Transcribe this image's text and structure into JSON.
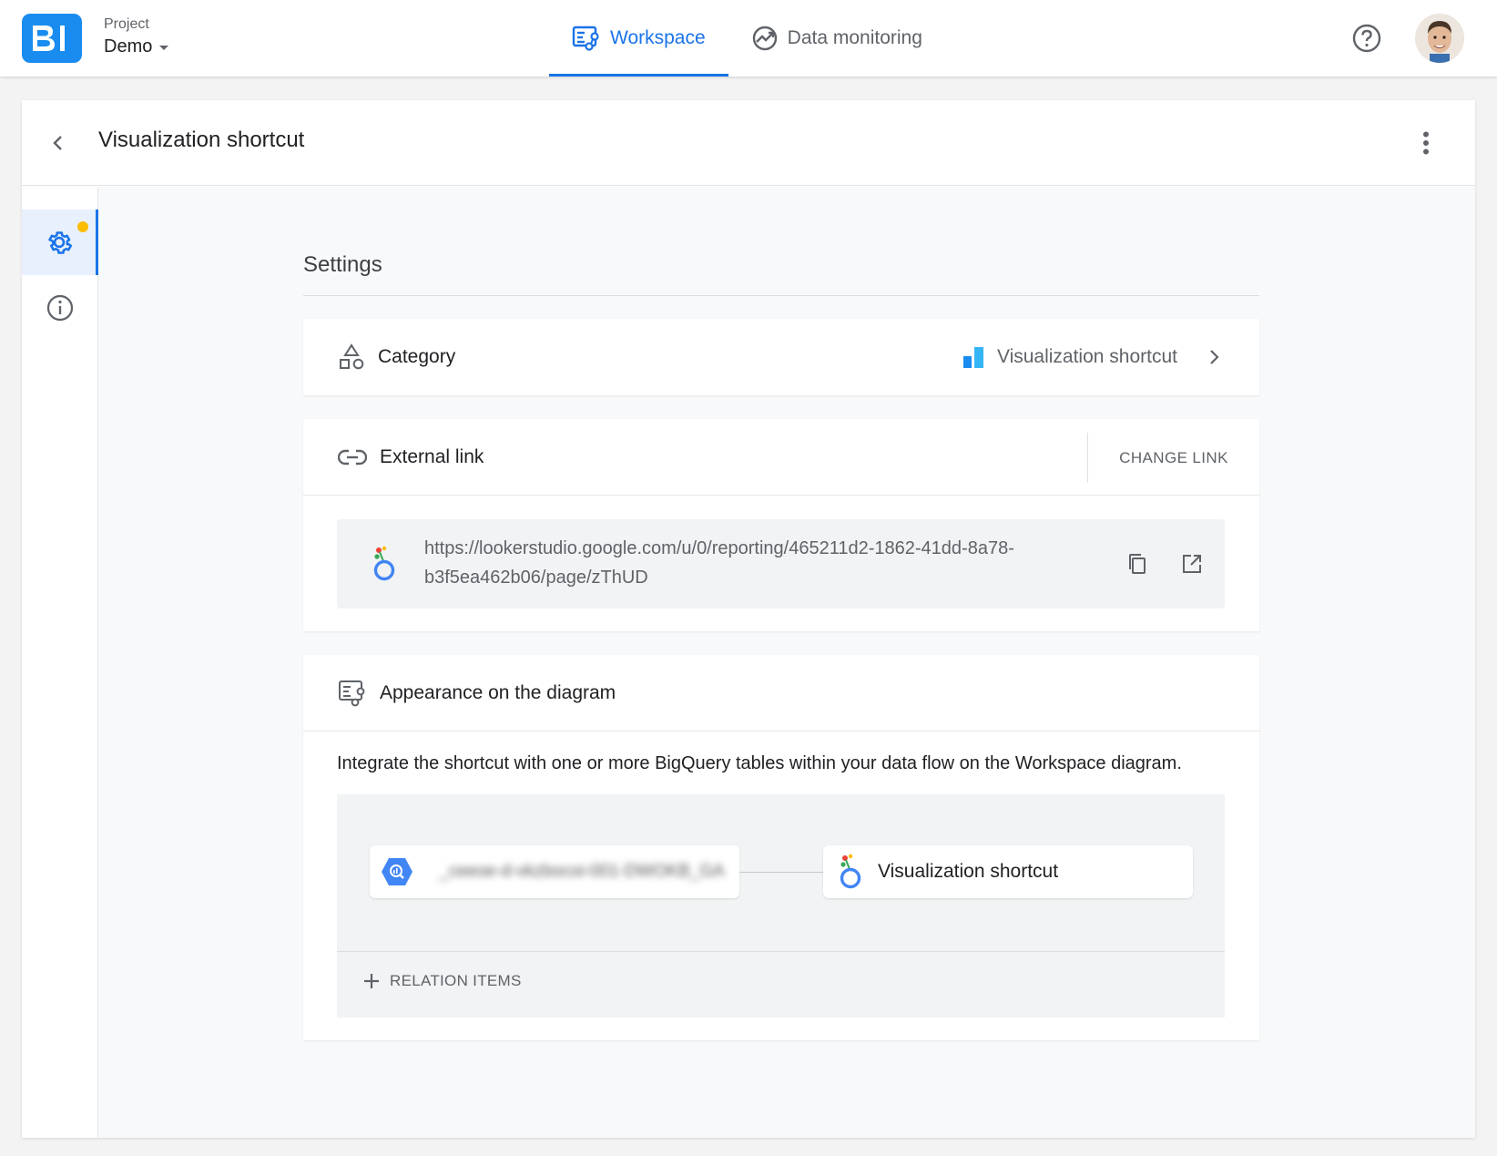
{
  "topbar": {
    "logo_text": "BI",
    "project_label": "Project",
    "project_name": "Demo",
    "tabs": [
      {
        "label": "Workspace",
        "active": true,
        "icon": "workspace-diagram-icon"
      },
      {
        "label": "Data monitoring",
        "active": false,
        "icon": "monitoring-icon"
      }
    ],
    "help_icon": "help-circle-icon",
    "accent_color": "#1a73e8",
    "logo_color": "#1a8cf0"
  },
  "page": {
    "title": "Visualization shortcut",
    "back_icon": "chevron-left-icon",
    "menu_icon": "more-vert-icon"
  },
  "side_rail": {
    "items": [
      {
        "name": "settings",
        "icon": "gear-icon",
        "active": true,
        "has_notification": true,
        "notification_color": "#fbbc04"
      },
      {
        "name": "info",
        "icon": "info-icon",
        "active": false
      }
    ]
  },
  "settings": {
    "title": "Settings",
    "category": {
      "label": "Category",
      "value": "Visualization shortcut",
      "icon": "shapes-icon",
      "value_icon": "bar-chart-icon"
    },
    "external_link": {
      "label": "External link",
      "action_label": "CHANGE LINK",
      "url_line1": "https://lookerstudio.google.com/u/0/reporting/465211d2-1862-41dd-8a78-",
      "url_line2": "b3f5ea462b06/page/zThUD",
      "copy_icon": "copy-icon",
      "open_icon": "open-in-new-icon"
    },
    "appearance": {
      "label": "Appearance on the diagram",
      "description": "Integrate the shortcut with one or more BigQuery tables within your data flow on the Workspace diagram.",
      "source_node_label": "_ceeoe-d-vkzbocoi-001-DWOKB_GA",
      "target_node_label": "Visualization shortcut",
      "relation_button": "RELATION ITEMS"
    }
  }
}
